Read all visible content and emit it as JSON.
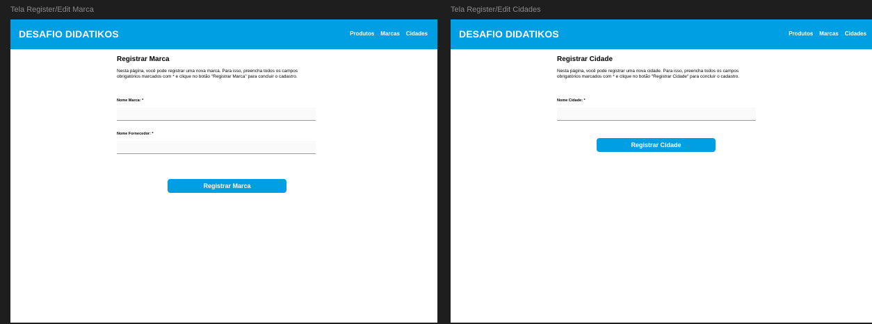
{
  "frames": [
    {
      "label": "Tela Register/Edit Marca",
      "brand": "DESAFIO DIDATIKOS",
      "nav": [
        "Produtos",
        "Marcas",
        "Cidades"
      ],
      "title": "Registrar Marca",
      "description": "Nesta página, você pode registrar uma nova marca. Para isso, preencha todos os campos obrigatórios marcados com * e clique no botão \"Registrar Marca\" para concluir o cadastro.",
      "fields": [
        {
          "label": "Nome Marca: *",
          "value": "",
          "placeholder": ""
        },
        {
          "label": "Nome Fornecedor: *",
          "value": "",
          "placeholder": ""
        }
      ],
      "button": "Registrar Marca"
    },
    {
      "label": "Tela Register/Edit Cidades",
      "brand": "DESAFIO DIDATIKOS",
      "nav": [
        "Produtos",
        "Marcas",
        "Cidades"
      ],
      "title": "Registrar Cidade",
      "description": "Nesta página, você pode registrar uma nova cidade. Para isso, preencha todos os campos obrigatórios marcados com * e clique no botão \"Registrar Cidade\" para concluir o cadastro.",
      "fields": [
        {
          "label": "Nome Cidade: *",
          "value": "",
          "placeholder": ""
        }
      ],
      "button": "Registrar Cidade"
    }
  ],
  "colors": {
    "canvas_background": "#1e1e1e",
    "frame_label": "#8a8a8a",
    "navbar": "#009ee3",
    "button": "#009ee3",
    "page_background": "#ffffff",
    "input_underline": "#999999"
  }
}
